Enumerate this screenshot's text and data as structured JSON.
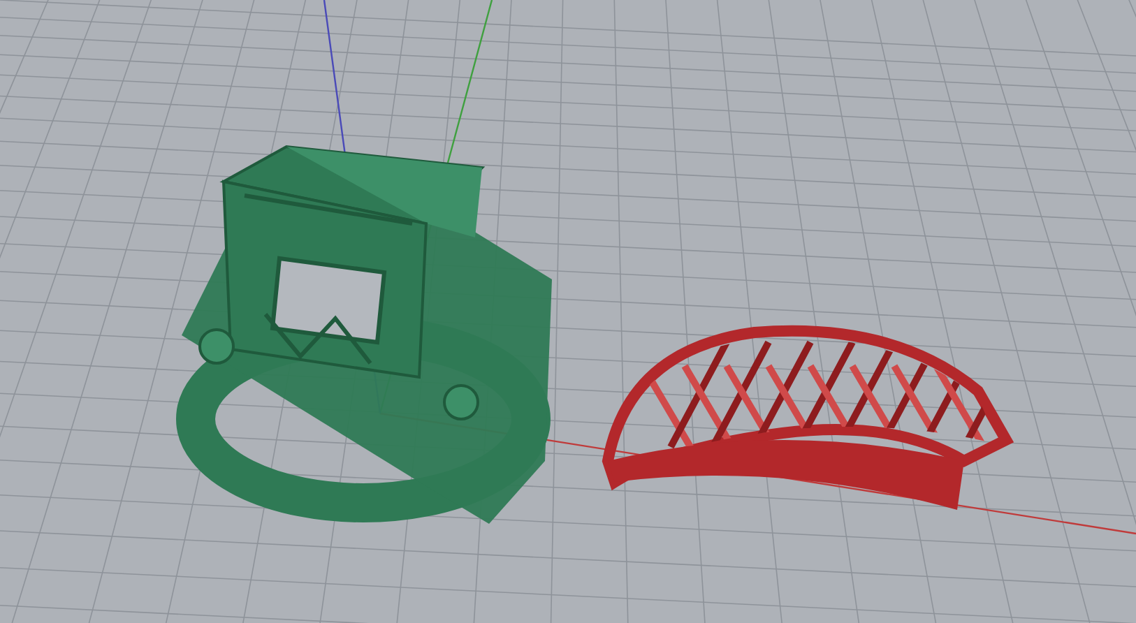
{
  "viewport": {
    "axes": [
      {
        "color": "#c03a3a"
      },
      {
        "color": "#3fa03f"
      },
      {
        "color": "#4a4ab8"
      }
    ],
    "objects": [
      {
        "color": "#2f7a55"
      },
      {
        "color": "#b3282b"
      }
    ]
  }
}
